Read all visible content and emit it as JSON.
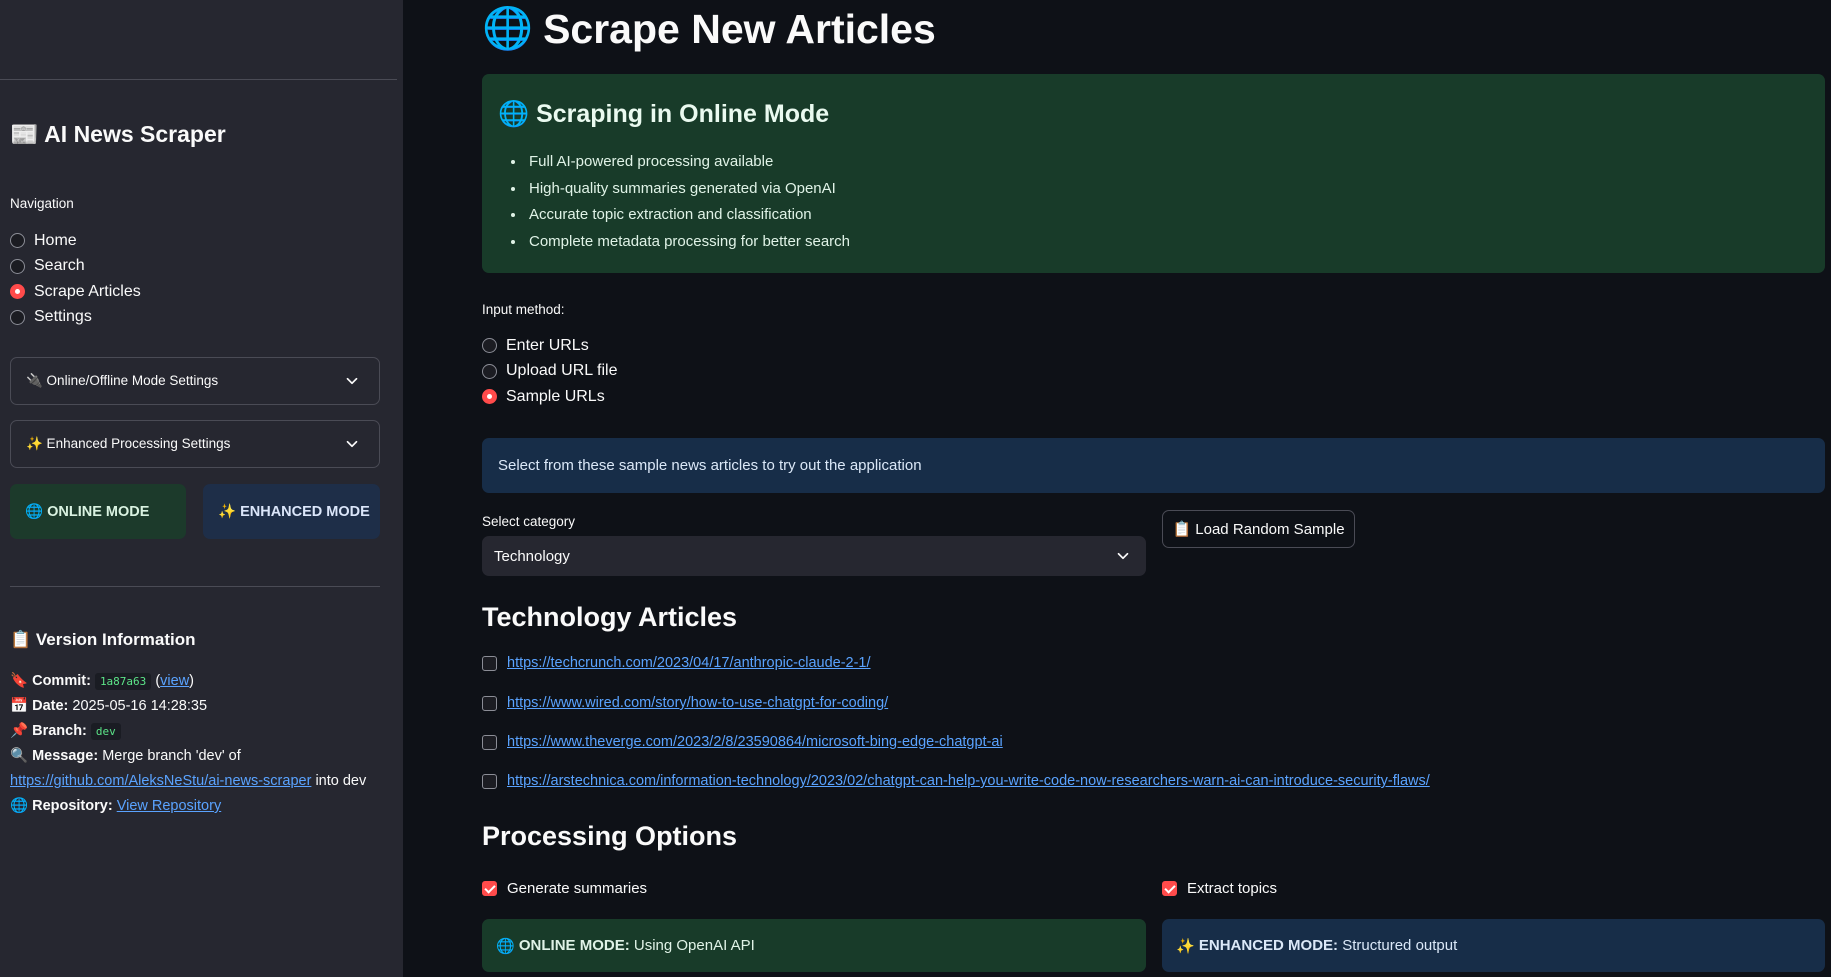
{
  "sidebar": {
    "title": "📰 AI News Scraper",
    "nav_label": "Navigation",
    "nav_items": [
      {
        "label": "Home",
        "selected": false
      },
      {
        "label": "Search",
        "selected": false
      },
      {
        "label": "Scrape Articles",
        "selected": true
      },
      {
        "label": "Settings",
        "selected": false
      }
    ],
    "expanders": [
      {
        "label": "🔌 Online/Offline Mode Settings"
      },
      {
        "label": "✨ Enhanced Processing Settings"
      }
    ],
    "mode_badges": {
      "online": "🌐 ONLINE MODE",
      "enhanced": "✨ ENHANCED MODE"
    },
    "version": {
      "title": "📋 Version Information",
      "commit_icon": "🔖",
      "commit_label": "Commit:",
      "commit_hash": "1a87a63",
      "commit_view": "view",
      "date_icon": "📅",
      "date_label": "Date:",
      "date_value": "2025-05-16 14:28:35",
      "branch_icon": "📌",
      "branch_label": "Branch:",
      "branch_value": "dev",
      "message_icon": "🔍",
      "message_label": "Message:",
      "message_value": "Merge branch 'dev' of",
      "message_link": "https://github.com/AleksNeStu/ai-news-scraper",
      "message_suffix": "into dev",
      "repo_icon": "🌐",
      "repo_label": "Repository:",
      "repo_link": "View Repository"
    }
  },
  "main": {
    "title_icon": "🌐",
    "title": "Scrape New Articles",
    "online_box": {
      "title": "🌐 Scraping in Online Mode",
      "bullets": [
        "Full AI-powered processing available",
        "High-quality summaries generated via OpenAI",
        "Accurate topic extraction and classification",
        "Complete metadata processing for better search"
      ]
    },
    "input_method": {
      "label": "Input method:",
      "options": [
        {
          "label": "Enter URLs",
          "selected": false
        },
        {
          "label": "Upload URL file",
          "selected": false
        },
        {
          "label": "Sample URLs",
          "selected": true
        }
      ]
    },
    "info_text": "Select from these sample news articles to try out the application",
    "category": {
      "label": "Select category",
      "value": "Technology"
    },
    "load_button": "📋 Load Random Sample",
    "articles_title": "Technology Articles",
    "articles": [
      "https://techcrunch.com/2023/04/17/anthropic-claude-2-1/",
      "https://www.wired.com/story/how-to-use-chatgpt-for-coding/",
      "https://www.theverge.com/2023/2/8/23590864/microsoft-bing-edge-chatgpt-ai",
      "https://arstechnica.com/information-technology/2023/02/chatgpt-can-help-you-write-code-now-researchers-warn-ai-can-introduce-security-flaws/"
    ],
    "processing_title": "Processing Options",
    "options": {
      "summaries": {
        "label": "Generate summaries",
        "checked": true
      },
      "topics": {
        "label": "Extract topics",
        "checked": true
      }
    },
    "status": {
      "online_icon": "🌐",
      "online_label": "ONLINE MODE:",
      "online_text": "Using OpenAI API",
      "enhanced_icon": "✨",
      "enhanced_label": "ENHANCED MODE:",
      "enhanced_text": "Structured output"
    }
  },
  "colors": {
    "accent": "#ff4b4b",
    "background": "#0e1117",
    "sidebar": "#262730",
    "success_bg": "#183b29",
    "info_bg": "#172d48",
    "link": "#5aa3ff"
  }
}
